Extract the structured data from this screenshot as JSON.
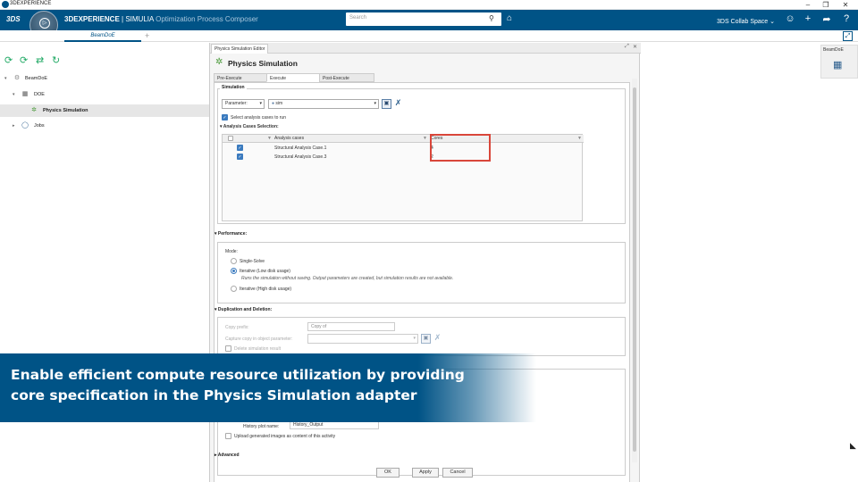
{
  "window": {
    "title": "3DEXPERIENCE",
    "controls": [
      "–",
      "❐",
      "✕"
    ]
  },
  "topbar": {
    "logo": "3DS",
    "compass_version": "V.6",
    "brand_bold": "3DEXPERIENCE",
    "brand_sep": " | SIMULIA ",
    "brand_app": "Optimization Process Composer",
    "search_placeholder": "Search",
    "collab_space": "3DS Collab Space",
    "colors": {
      "bar": "#005386",
      "accent": "#3b7bbf"
    }
  },
  "tabs": {
    "active": "BeamDoE",
    "add": "+"
  },
  "tree": {
    "toolbar_icons": [
      "run-icon",
      "run-all-icon",
      "sync-icon",
      "refresh-icon"
    ],
    "nodes": [
      {
        "label": "BeamDoE",
        "level": 0
      },
      {
        "label": "DOE",
        "level": 1
      },
      {
        "label": "Physics Simulation",
        "level": 2,
        "selected": true
      },
      {
        "label": "Jobs",
        "level": 1
      }
    ]
  },
  "editor": {
    "tab_label": "Physics Simulation Editor",
    "title": "Physics Simulation",
    "subtabs": [
      "Pre-Execute",
      "Execute",
      "Post-Execute"
    ],
    "active_subtab": "Execute",
    "simulation": {
      "group_label": "Simulation",
      "param_dropdown": "Parameter:",
      "param_value": "sim",
      "select_cases_label": "Select analysis cases to run",
      "cases_label": "Analysis Cases Selection:",
      "columns": [
        "Analysis cases",
        "Cores"
      ],
      "rows": [
        {
          "name": "Structural Analysis Case.1",
          "cores": "4",
          "checked": true
        },
        {
          "name": "Structural Analysis Case.3",
          "cores": "2",
          "checked": true
        }
      ]
    },
    "performance": {
      "label": "Performance:",
      "mode_label": "Mode:",
      "options": [
        "Single-Solve",
        "Iterative (Low disk usage)",
        "Iterative (High disk usage)"
      ],
      "selected": "Iterative (Low disk usage)",
      "note": "Runs the simulation without saving. Output parameters are created, but simulation results are not available."
    },
    "duplication": {
      "label": "Duplication and Deletion:",
      "copy_prefix_label": "Copy prefix:",
      "copy_prefix_value": "Copy of",
      "capture_label": "Capture copy in object parameter:",
      "delete_label": "Delete simulation result"
    },
    "history": {
      "plot_name_label": "History plot name:",
      "plot_name_value": "History_Output",
      "upload_label": "Upload generated images as content of this activity"
    },
    "advanced_label": "Advanced",
    "buttons": {
      "ok": "OK",
      "apply": "Apply",
      "cancel": "Cancel"
    }
  },
  "right_panel": {
    "chip_label": "BeamDoE"
  },
  "banner": {
    "line1": "Enable efficient compute resource utilization by providing",
    "line2": "core specification in the Physics Simulation adapter"
  }
}
